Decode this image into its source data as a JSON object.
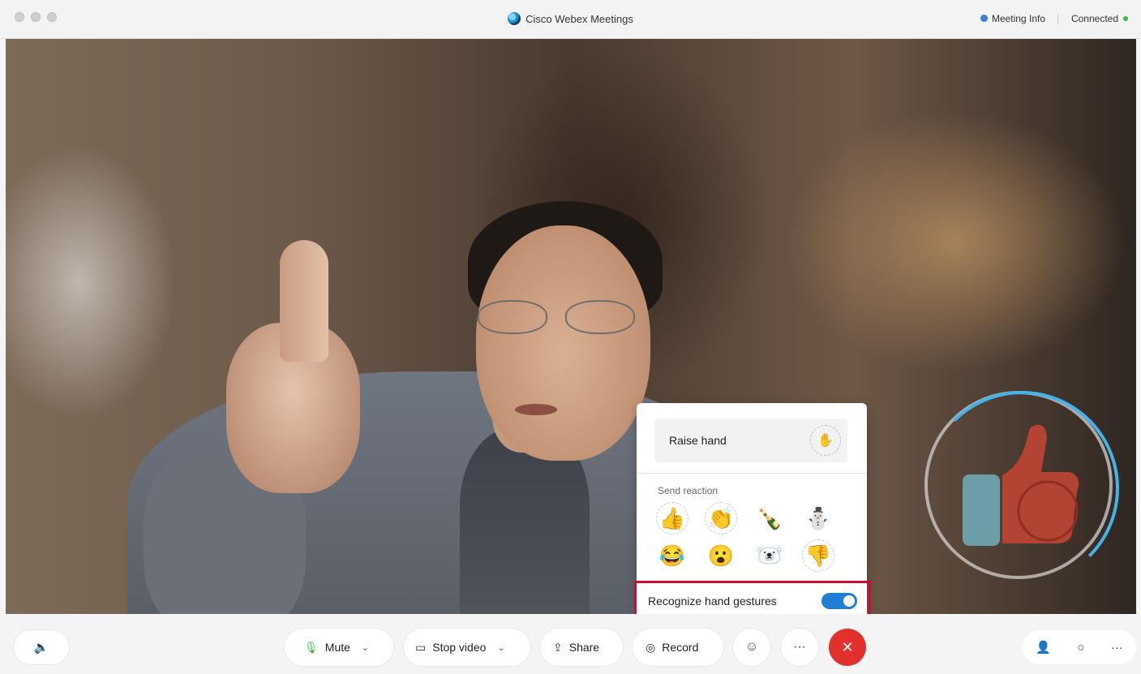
{
  "window": {
    "title": "Cisco Webex Meetings",
    "meeting_info": "Meeting Info",
    "status": "Connected"
  },
  "popover": {
    "raise_hand": "Raise hand",
    "send_reaction": "Send reaction",
    "emojis": [
      "👍",
      "👏",
      "🍾",
      "⛄",
      "😂",
      "😮",
      "🐻‍❄️",
      "👎"
    ],
    "recognize_gestures": "Recognize hand gestures",
    "recognize_gestures_enabled": true
  },
  "toolbar": {
    "mute": "Mute",
    "stop_video": "Stop video",
    "share": "Share",
    "record": "Record"
  },
  "icons": {
    "mic": "microphone-icon",
    "camera": "camera-icon",
    "share": "share-icon",
    "record": "record-icon",
    "reactions": "smiley-icon",
    "more": "more-icon",
    "end": "close-icon",
    "participants": "participants-icon",
    "chat": "chat-icon"
  },
  "colors": {
    "end_call": "#e2302c",
    "toggle_on": "#1f7ed6",
    "highlight": "#c8102e",
    "reaction_ring": "#42b4ea"
  }
}
